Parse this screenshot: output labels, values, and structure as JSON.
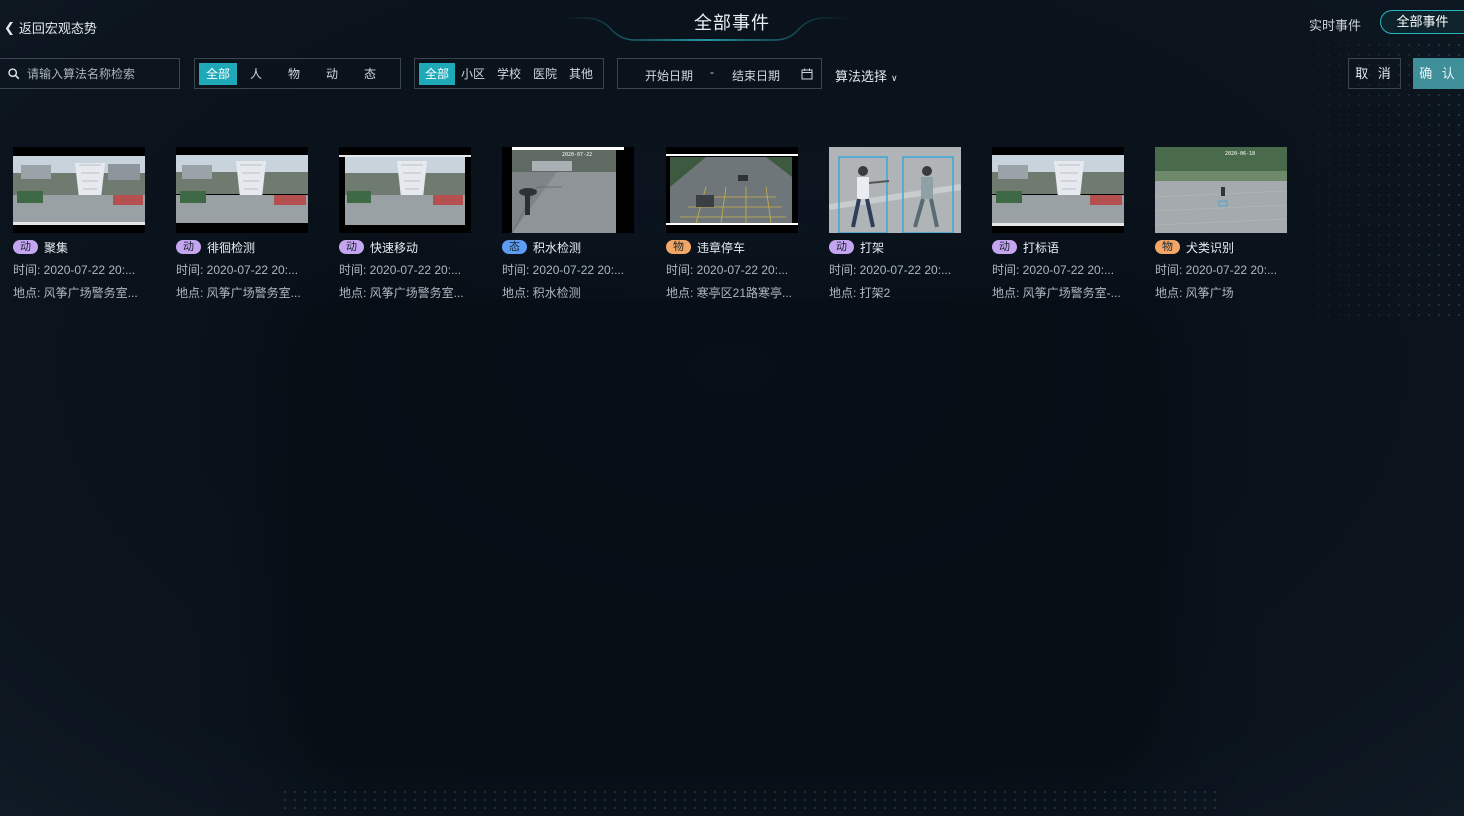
{
  "header": {
    "back_label": "返回宏观态势",
    "title": "全部事件",
    "tab_realtime": "实时事件",
    "tab_all": "全部事件"
  },
  "filters": {
    "search_placeholder": "请输入算法名称检索",
    "type_options": [
      "全部",
      "人",
      "物",
      "动",
      "态"
    ],
    "type_selected": "全部",
    "place_options": [
      "全部",
      "小区",
      "学校",
      "医院",
      "其他"
    ],
    "place_selected": "全部",
    "start_date_placeholder": "开始日期",
    "date_separator": "-",
    "end_date_placeholder": "结束日期",
    "algo_select_label": "算法选择",
    "cancel_label": "取 消",
    "confirm_label": "确 认"
  },
  "colors": {
    "accent": "#1fa9b8",
    "badge_dong": "#c5a5f0",
    "badge_tai": "#5c9cf2",
    "badge_wu": "#f2a766"
  },
  "events": [
    {
      "badge": "动",
      "badge_type": "dong",
      "name": "聚集",
      "time": "时间: 2020-07-22 20:...",
      "place": "地点: 风筝广场警务室..."
    },
    {
      "badge": "动",
      "badge_type": "dong",
      "name": "徘徊检测",
      "time": "时间: 2020-07-22 20:...",
      "place": "地点: 风筝广场警务室..."
    },
    {
      "badge": "动",
      "badge_type": "dong",
      "name": "快速移动",
      "time": "时间: 2020-07-22 20:...",
      "place": "地点: 风筝广场警务室..."
    },
    {
      "badge": "态",
      "badge_type": "tai",
      "name": "积水检测",
      "time": "时间: 2020-07-22 20:...",
      "place": "地点: 积水检测"
    },
    {
      "badge": "物",
      "badge_type": "wu",
      "name": "违章停车",
      "time": "时间: 2020-07-22 20:...",
      "place": "地点: 寒亭区21路寒亭..."
    },
    {
      "badge": "动",
      "badge_type": "dong",
      "name": "打架",
      "time": "时间: 2020-07-22 20:...",
      "place": "地点: 打架2"
    },
    {
      "badge": "动",
      "badge_type": "dong",
      "name": "打标语",
      "time": "时间: 2020-07-22 20:...",
      "place": "地点: 风筝广场警务室-..."
    },
    {
      "badge": "物",
      "badge_type": "wu",
      "name": "犬类识别",
      "time": "时间: 2020-07-22 20:...",
      "place": "地点: 风筝广场"
    }
  ]
}
